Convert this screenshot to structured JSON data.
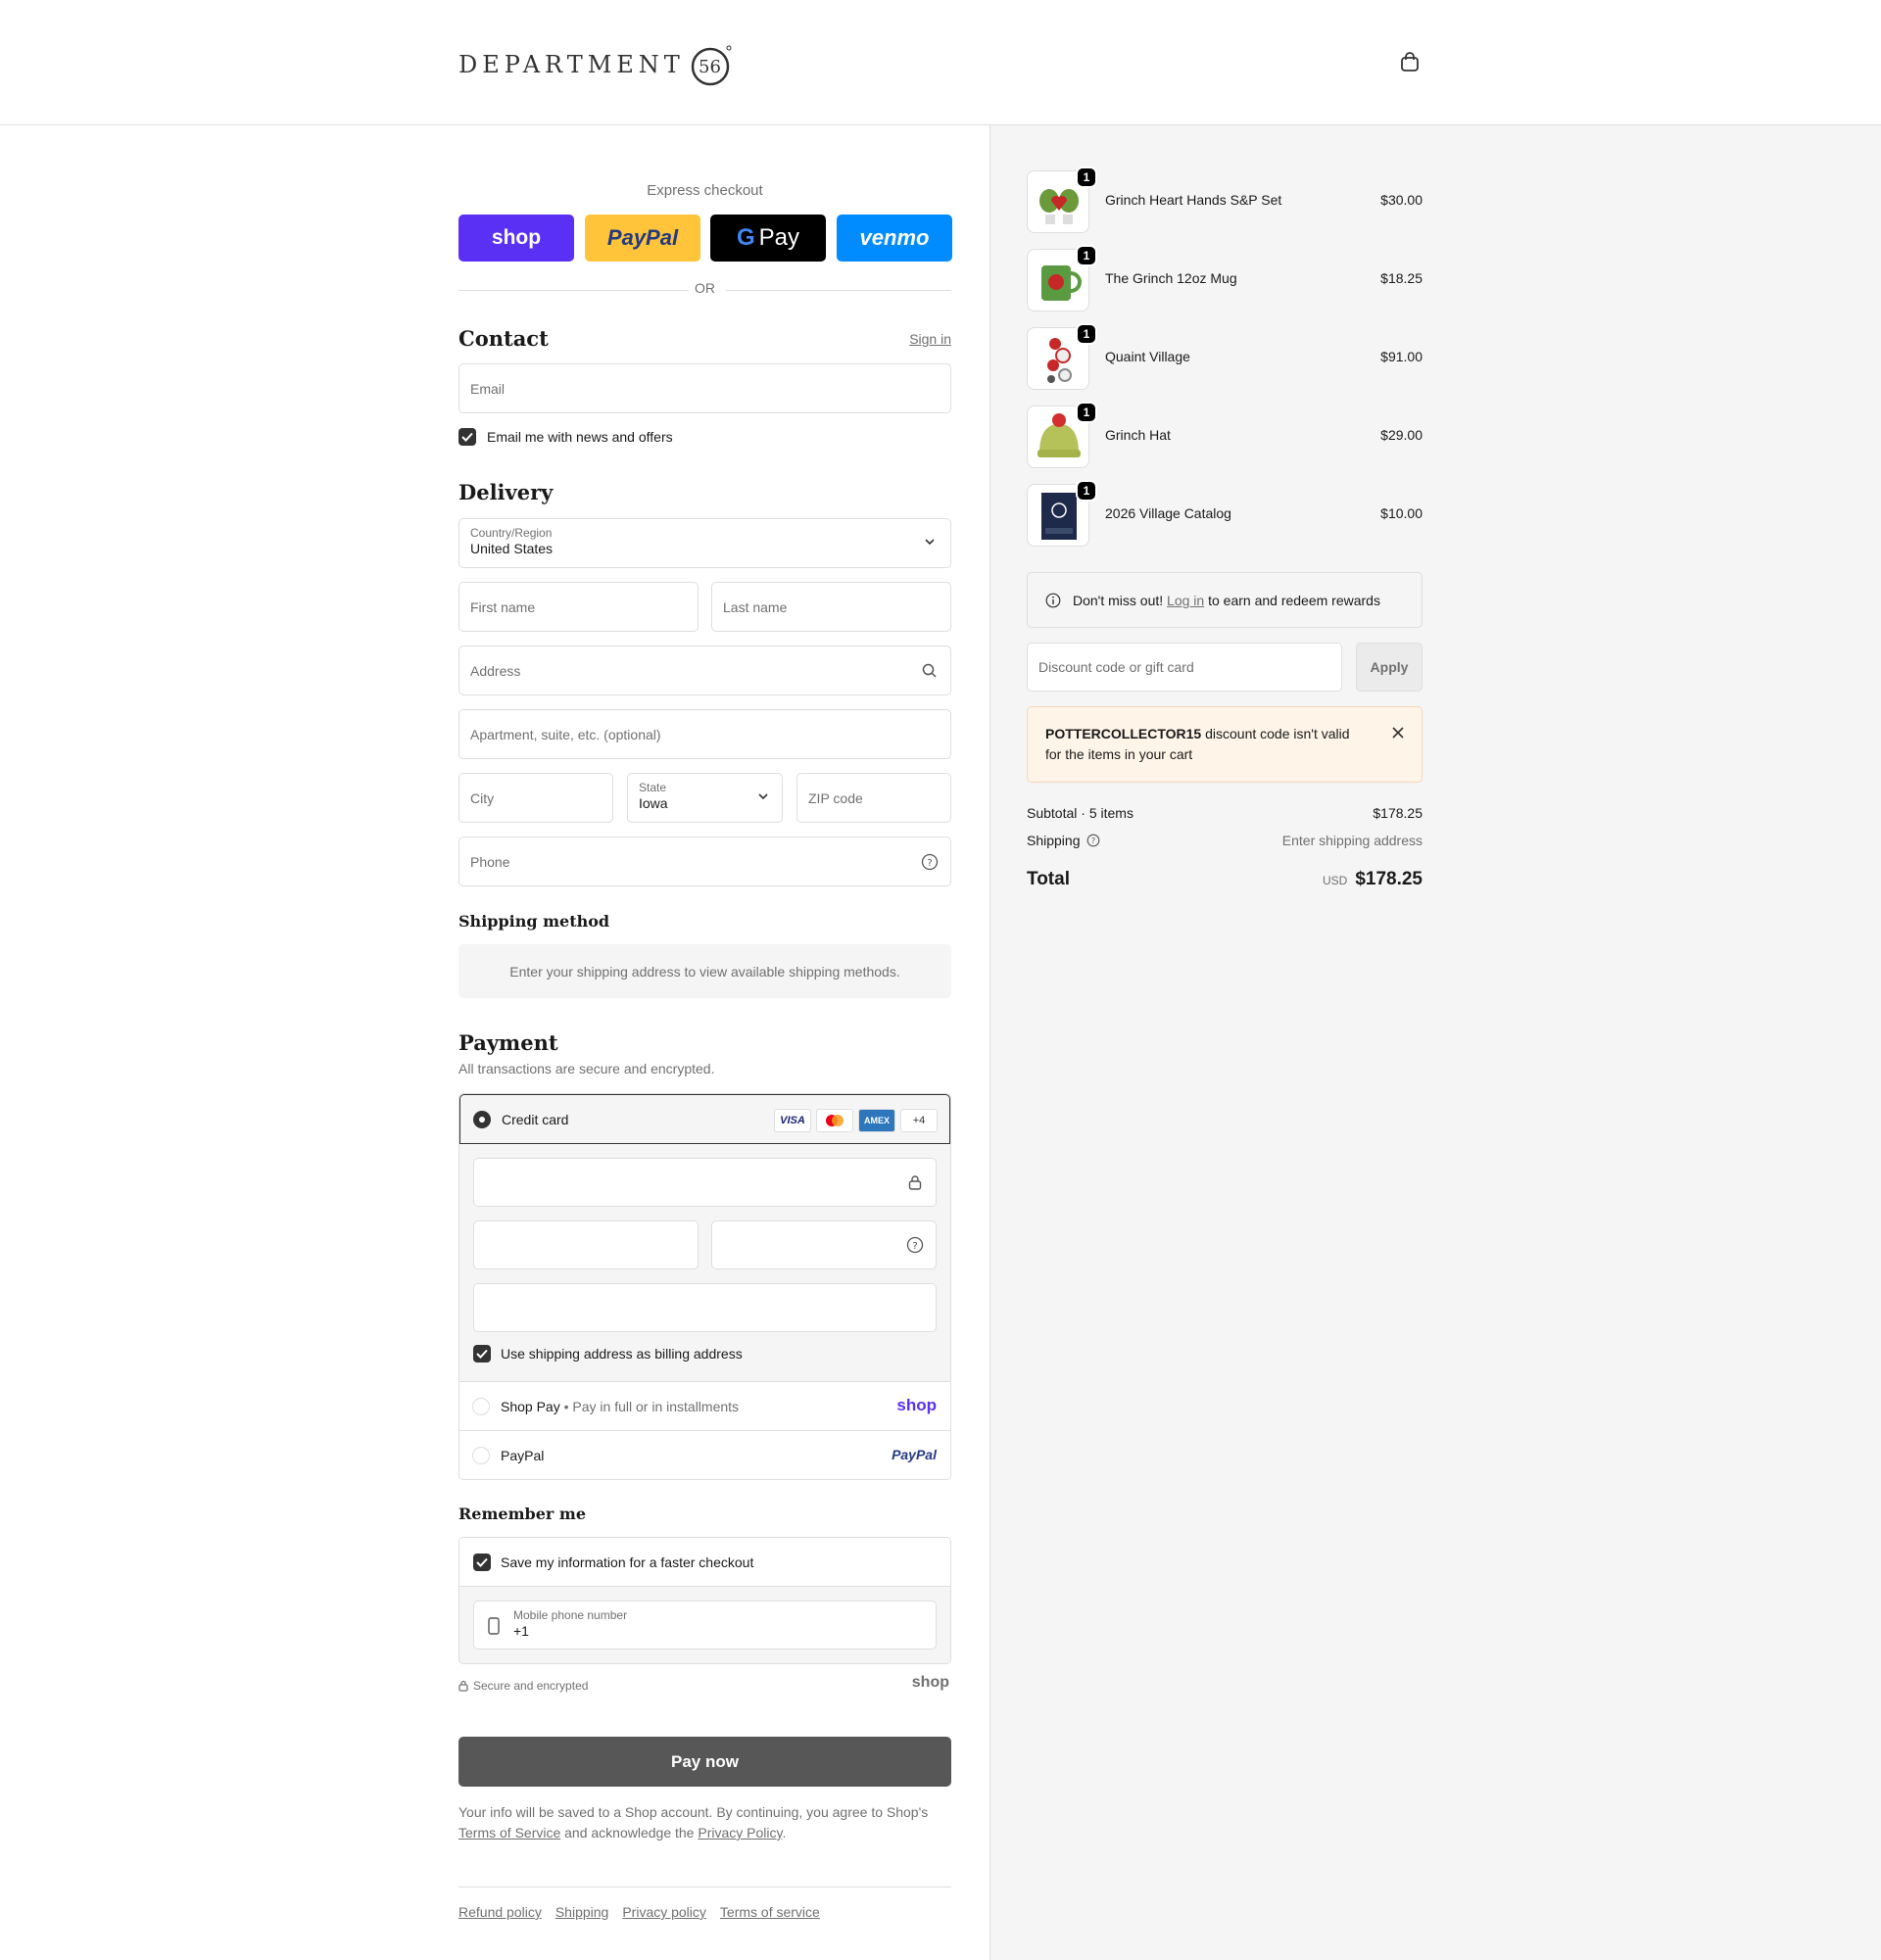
{
  "brand": {
    "logo_text": "DEPARTMENT",
    "logo_alt": "Department 56"
  },
  "express": {
    "label": "Express checkout",
    "shop": "shop",
    "paypal": "PayPal",
    "gpay": "Pay",
    "venmo": "venmo",
    "or": "OR"
  },
  "contact": {
    "title": "Contact",
    "sign_in": "Sign in",
    "email_placeholder": "Email",
    "newsletter": "Email me with news and offers"
  },
  "delivery": {
    "title": "Delivery",
    "country_label": "Country/Region",
    "country_value": "United States",
    "first_name": "First name",
    "last_name": "Last name",
    "address": "Address",
    "apartment": "Apartment, suite, etc. (optional)",
    "city": "City",
    "state_label": "State",
    "state_value": "Iowa",
    "zip": "ZIP code",
    "phone": "Phone"
  },
  "shipping_method": {
    "title": "Shipping method",
    "notice": "Enter your shipping address to view available shipping methods."
  },
  "payment": {
    "title": "Payment",
    "subtitle": "All transactions are secure and encrypted.",
    "credit_card": "Credit card",
    "cards": [
      "VISA",
      "MC",
      "AMEX",
      "+4"
    ],
    "billing_same": "Use shipping address as billing address",
    "shop_pay": "Shop Pay",
    "shop_pay_sub": "Pay in full or in installments",
    "shop_pay_logo": "shop",
    "paypal": "PayPal",
    "paypal_logo": "PayPal"
  },
  "remember": {
    "title": "Remember me",
    "save_info": "Save my information for a faster checkout",
    "mobile_label": "Mobile phone number",
    "mobile_value": "+1",
    "secure": "Secure and encrypted",
    "shop_logo": "shop"
  },
  "pay_button": "Pay now",
  "legal": {
    "line1": "Your info will be saved to a Shop account. By continuing, you agree to Shop's",
    "tos": "Terms of Service",
    "middle": "and acknowledge the",
    "privacy": "Privacy Policy",
    "end": "."
  },
  "footer": {
    "refund": "Refund policy",
    "shipping": "Shipping",
    "privacy": "Privacy policy",
    "terms": "Terms of service"
  },
  "cart": {
    "items": [
      {
        "name": "Grinch Heart Hands S&P Set",
        "price": "$30.00",
        "qty": "1"
      },
      {
        "name": "The Grinch 12oz Mug",
        "price": "$18.25",
        "qty": "1"
      },
      {
        "name": "Quaint Village",
        "price": "$91.00",
        "qty": "1"
      },
      {
        "name": "Grinch Hat",
        "price": "$29.00",
        "qty": "1"
      },
      {
        "name": "2026 Village Catalog",
        "price": "$10.00",
        "qty": "1"
      }
    ]
  },
  "rewards": {
    "pre": "Don't miss out!",
    "link": "Log in",
    "post": "to earn and redeem rewards"
  },
  "discount": {
    "placeholder": "Discount code or gift card",
    "apply": "Apply",
    "error_code": "POTTERCOLLECTOR15",
    "error_msg": "discount code isn't valid for the items in your cart"
  },
  "summary": {
    "subtotal_label": "Subtotal · 5 items",
    "subtotal": "$178.25",
    "shipping_label": "Shipping",
    "shipping_value": "Enter shipping address",
    "total_label": "Total",
    "currency": "USD",
    "total": "$178.25"
  },
  "colors": {
    "shop_purple": "#5a31f4",
    "paypal_yellow": "#ffc439",
    "venmo_blue": "#008cff",
    "pay_button": "#575757"
  }
}
